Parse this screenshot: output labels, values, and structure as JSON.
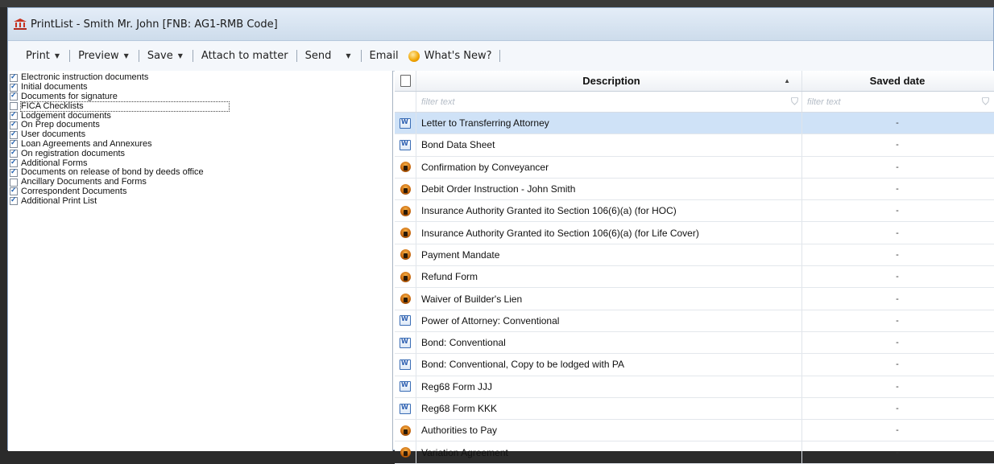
{
  "window": {
    "title": "PrintList - Smith Mr. John [FNB: AG1-RMB Code]"
  },
  "toolbar": {
    "print": "Print",
    "preview": "Preview",
    "save": "Save",
    "attach": "Attach to matter",
    "send": "Send",
    "email": "Email",
    "whats_new": "What's New?"
  },
  "categories": [
    {
      "label": "Electronic instruction documents",
      "checked": true
    },
    {
      "label": "Initial documents",
      "checked": true
    },
    {
      "label": "Documents for signature",
      "checked": true
    },
    {
      "label": "FICA Checklists",
      "checked": false
    },
    {
      "label": "Lodgement documents",
      "checked": true
    },
    {
      "label": "On Prep documents",
      "checked": true
    },
    {
      "label": "User documents",
      "checked": true
    },
    {
      "label": "Loan Agreements and Annexures",
      "checked": true
    },
    {
      "label": "On registration documents",
      "checked": true
    },
    {
      "label": "Additional Forms",
      "checked": true
    },
    {
      "label": "Documents on release of bond by deeds office",
      "checked": true
    },
    {
      "label": "Ancillary Documents and Forms",
      "checked": false
    },
    {
      "label": "Correspondent Documents",
      "checked": true
    },
    {
      "label": "Additional Print List",
      "checked": true
    }
  ],
  "grid": {
    "col_description": "Description",
    "col_saved_date": "Saved date",
    "filter_placeholder_desc": "filter text",
    "filter_placeholder_date": "filter text",
    "rows": [
      {
        "icon": "word-doc-icon",
        "description": "Letter to Transferring Attorney",
        "saved": "-"
      },
      {
        "icon": "word-doc-icon",
        "description": "Bond Data Sheet",
        "saved": "-"
      },
      {
        "icon": "pdf-form-icon",
        "description": "Confirmation by Conveyancer",
        "saved": "-"
      },
      {
        "icon": "pdf-form-icon",
        "description": "Debit Order Instruction - John Smith",
        "saved": "-"
      },
      {
        "icon": "pdf-form-icon",
        "description": "Insurance Authority Granted ito Section 106(6)(a) (for HOC)",
        "saved": "-"
      },
      {
        "icon": "pdf-form-icon",
        "description": "Insurance Authority Granted ito Section 106(6)(a) (for Life Cover)",
        "saved": "-"
      },
      {
        "icon": "pdf-form-icon",
        "description": "Payment Mandate",
        "saved": "-"
      },
      {
        "icon": "pdf-form-icon",
        "description": "Refund Form",
        "saved": "-"
      },
      {
        "icon": "pdf-form-icon",
        "description": "Waiver of Builder's Lien",
        "saved": "-"
      },
      {
        "icon": "word-doc-icon",
        "description": "Power of Attorney: Conventional",
        "saved": "-"
      },
      {
        "icon": "word-doc-icon",
        "description": "Bond: Conventional",
        "saved": "-"
      },
      {
        "icon": "word-doc-icon",
        "description": "Bond: Conventional, Copy to be lodged with PA",
        "saved": "-"
      },
      {
        "icon": "word-doc-icon",
        "description": "Reg68 Form JJJ",
        "saved": "-"
      },
      {
        "icon": "word-doc-icon",
        "description": "Reg68 Form KKK",
        "saved": "-"
      },
      {
        "icon": "pdf-form-icon",
        "description": "Authorities to Pay",
        "saved": "-"
      },
      {
        "icon": "pdf-form-icon",
        "description": "Variation Agreement",
        "saved": "-"
      }
    ]
  },
  "colors": {
    "selected_row": "#cfe2f7",
    "titlebar": "#cddceb",
    "check": "#1f5fae"
  }
}
